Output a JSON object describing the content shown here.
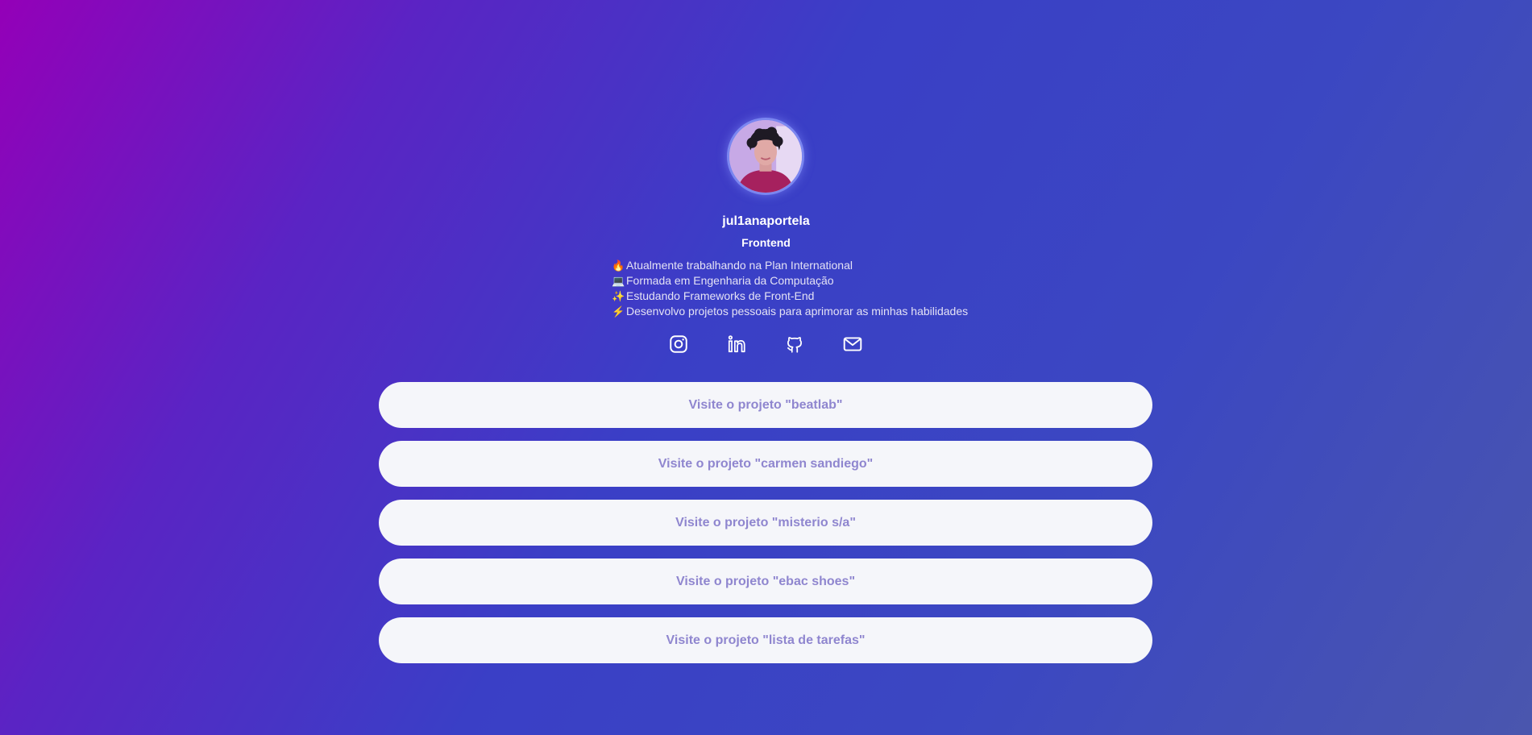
{
  "profile": {
    "username": "jul1anaportela",
    "role": "Frontend",
    "bio": [
      {
        "emoji": "🔥",
        "emoji_icon": "fire-icon",
        "text": "Atualmente trabalhando na Plan International"
      },
      {
        "emoji": "💻",
        "emoji_icon": "laptop-icon",
        "text": "Formada em Engenharia da Computação"
      },
      {
        "emoji": "✨",
        "emoji_icon": "sparkles-icon",
        "text": "Estudando Frameworks de Front-End"
      },
      {
        "emoji": "⚡",
        "emoji_icon": "lightning-icon",
        "text": "Desenvolvo projetos pessoais para aprimorar as minhas habilidades"
      }
    ]
  },
  "socials": [
    {
      "name": "instagram",
      "icon": "instagram-icon"
    },
    {
      "name": "linkedin",
      "icon": "linkedin-icon"
    },
    {
      "name": "github",
      "icon": "github-icon"
    },
    {
      "name": "email",
      "icon": "mail-icon"
    }
  ],
  "links": [
    {
      "label": "Visite o projeto \"beatlab\""
    },
    {
      "label": "Visite o projeto \"carmen sandiego\""
    },
    {
      "label": "Visite o projeto \"misterio s/a\""
    },
    {
      "label": "Visite o projeto \"ebac shoes\""
    },
    {
      "label": "Visite o projeto \"lista de tarefas\""
    }
  ],
  "colors": {
    "gradient_start": "#9400b8",
    "gradient_mid": "#3a3fc6",
    "gradient_end": "#4a56ae",
    "button_bg": "#f5f6fa",
    "button_text": "#8f86cf",
    "avatar_ring": "#7a86f0"
  }
}
